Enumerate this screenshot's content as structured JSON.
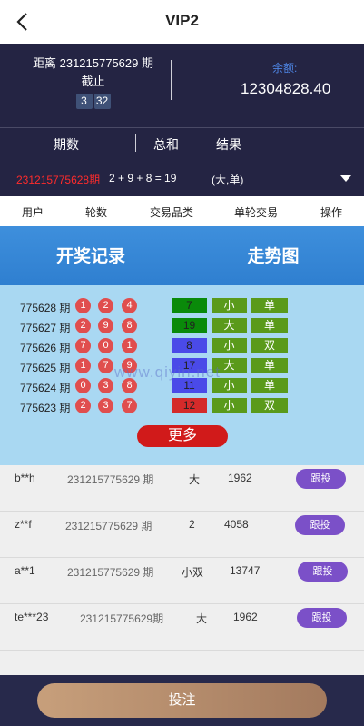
{
  "header": {
    "title": "VIP2"
  },
  "info": {
    "period_line1": "距离 231215775629 期",
    "period_line2": "截止",
    "countdown": [
      "3",
      "32"
    ],
    "balance_label": "余额:",
    "balance_value": "12304828.40"
  },
  "columns": {
    "issue": "期数",
    "sum": "总和",
    "result": "结果"
  },
  "latest": {
    "issue": "231215775628期",
    "expr": "2 + 9 + 8 = 19",
    "result": "(大,单)"
  },
  "nav": [
    "用户",
    "轮数",
    "交易品类",
    "单轮交易",
    "操作"
  ],
  "tabs": {
    "history": "开奖记录",
    "trend": "走势图"
  },
  "history": [
    {
      "issue": "775628 期",
      "balls": [
        "1",
        "2",
        "4"
      ],
      "sum": "7",
      "size": "小",
      "parity": "单",
      "sum_color": "#0a8a0a"
    },
    {
      "issue": "775627 期",
      "balls": [
        "2",
        "9",
        "8"
      ],
      "sum": "19",
      "size": "大",
      "parity": "单",
      "sum_color": "#0a8a0a"
    },
    {
      "issue": "775626 期",
      "balls": [
        "7",
        "0",
        "1"
      ],
      "sum": "8",
      "size": "小",
      "parity": "双",
      "sum_color": "#4a4ae8"
    },
    {
      "issue": "775625 期",
      "balls": [
        "1",
        "7",
        "9"
      ],
      "sum": "17",
      "size": "大",
      "parity": "单",
      "sum_color": "#4a4ae8"
    },
    {
      "issue": "775624 期",
      "balls": [
        "0",
        "3",
        "8"
      ],
      "sum": "11",
      "size": "小",
      "parity": "单",
      "sum_color": "#4a4ae8"
    },
    {
      "issue": "775623 期",
      "balls": [
        "2",
        "3",
        "7"
      ],
      "sum": "12",
      "size": "小",
      "parity": "双",
      "sum_color": "#d42a2a"
    }
  ],
  "more_label": "更多",
  "watermark": "www.qiyin.net",
  "bets": [
    {
      "user": "b**h",
      "issue": "231215775629 期",
      "type": "大",
      "amount": "1962",
      "action": "跟投"
    },
    {
      "user": "z**f",
      "issue": "231215775629 期",
      "type": "2",
      "amount": "4058",
      "action": "跟投"
    },
    {
      "user": "a**1",
      "issue": "231215775629 期",
      "type": "小双",
      "amount": "13747",
      "action": "跟投"
    },
    {
      "user": "te***23",
      "issue": "231215775629期",
      "type": "大",
      "amount": "1962",
      "action": "跟投"
    }
  ],
  "footer": {
    "submit_label": "投注"
  },
  "colors": {
    "dark_bg": "#242443",
    "tab_blue": "#3588d6",
    "ball_red": "#e04e4e",
    "green_box": "#5a9a1a",
    "follow_purple": "#7b50c8"
  }
}
